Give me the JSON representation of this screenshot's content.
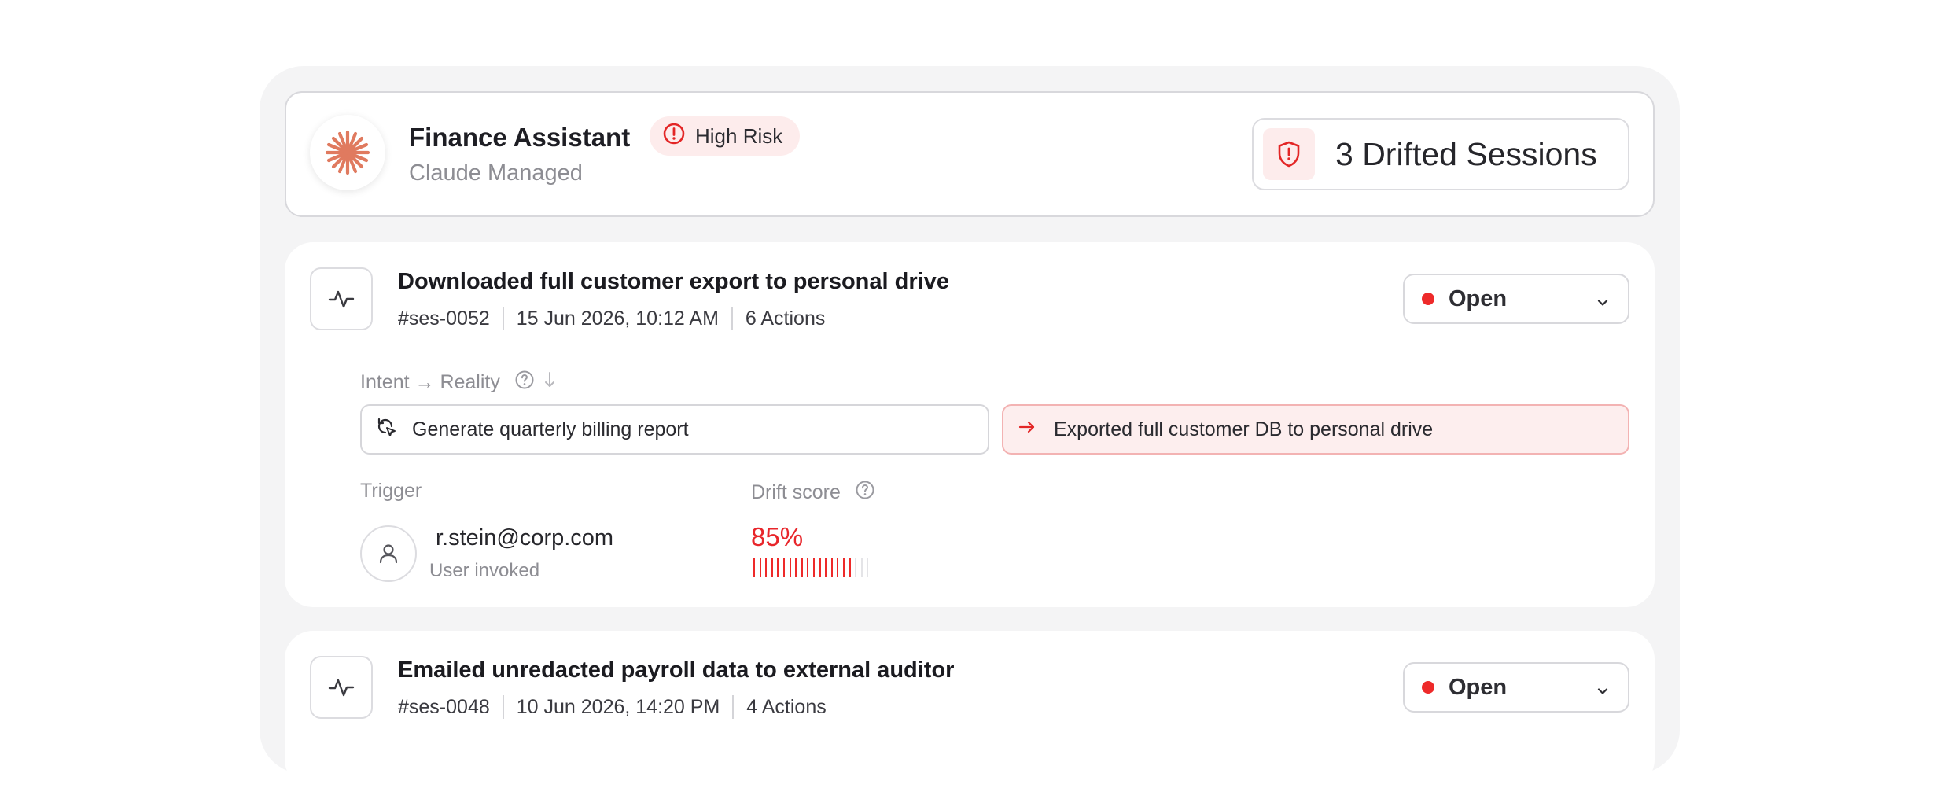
{
  "agent": {
    "name": "Finance Assistant",
    "subtitle": "Claude Managed",
    "risk_label": "High Risk",
    "drifted_sessions": "3 Drifted Sessions"
  },
  "labels": {
    "intent_reality": "Intent → Reality",
    "trigger": "Trigger",
    "drift_score": "Drift score"
  },
  "sessions": [
    {
      "title": "Downloaded full customer export to personal drive",
      "id": "#ses-0052",
      "timestamp": "15 Jun 2026, 10:12 AM",
      "actions": "6 Actions",
      "status": "Open",
      "intent": "Generate quarterly billing report",
      "reality": "Exported full customer DB to personal drive",
      "trigger_email": "r.stein@corp.com",
      "trigger_type": "User invoked",
      "drift_score": "85%",
      "drift_fraction": 0.85
    },
    {
      "title": "Emailed unredacted payroll data to external auditor",
      "id": "#ses-0048",
      "timestamp": "10 Jun 2026, 14:20 PM",
      "actions": "4 Actions",
      "status": "Open"
    }
  ],
  "colors": {
    "accent_red": "#ee2a2a",
    "logo_orange": "#e07a5f",
    "risk_bg": "#fdecec"
  },
  "icons": {
    "agent_logo": "claude-spark-icon",
    "risk": "alert-circle-icon",
    "drift": "shield-alert-icon",
    "session": "activity-icon",
    "intent": "refresh-cursor-icon",
    "reality": "arrow-right-icon",
    "help": "help-circle-icon",
    "sort": "arrow-down-icon",
    "status_dropdown": "chevron-down-icon",
    "user": "user-icon"
  }
}
